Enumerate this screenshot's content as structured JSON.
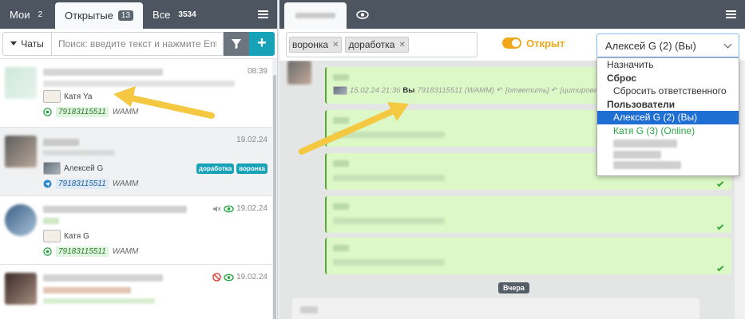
{
  "left": {
    "tabs": [
      {
        "label": "Мои",
        "count": "2"
      },
      {
        "label": "Открытые",
        "count": "13"
      },
      {
        "label": "Все",
        "count": "3534"
      }
    ],
    "chats_dropdown": "Чаты",
    "search_placeholder": "Поиск: введите текст и нажмите Enter",
    "items": [
      {
        "time": "08:39",
        "assignee": "Катя Ya",
        "phone": "79183115511",
        "via": "WAMM",
        "channel": "whatsapp"
      },
      {
        "time": "19.02.24",
        "assignee": "Алексей G",
        "phone": "79183115511",
        "via": "WAMM",
        "channel": "telegram",
        "tags": [
          "доработка",
          "воронка"
        ]
      },
      {
        "time": "19.02.24",
        "assignee": "Катя G",
        "phone": "79183115511",
        "via": "WAMM",
        "channel": "whatsapp"
      },
      {
        "time": "19.02.24"
      }
    ]
  },
  "right": {
    "tags": [
      "воронка",
      "доработка"
    ],
    "status": "Открыт",
    "responsible_select": "Алексей G (2) (Вы)",
    "dropdown": {
      "assign": "Назначить",
      "group_reset": "Сброс",
      "reset_item": "Сбросить ответственного",
      "group_users": "Пользователи",
      "user_selected": "Алексей G (2) (Вы)",
      "user_online": "Катя G (3) (Online)"
    },
    "message_meta": {
      "datetime": "15.02.24 21:36",
      "author": "Вы",
      "phone": "79183115511 (WAMM)",
      "reply": "[ответить]",
      "quote": "[цитировать]"
    },
    "day_separator": "Вчера"
  },
  "colors": {
    "topbar": "#4c5560",
    "accent_teal": "#17a2b8",
    "status_orange": "#f0a81a",
    "bubble_green": "#dcf8c6",
    "selected_blue": "#1e6ed3"
  }
}
